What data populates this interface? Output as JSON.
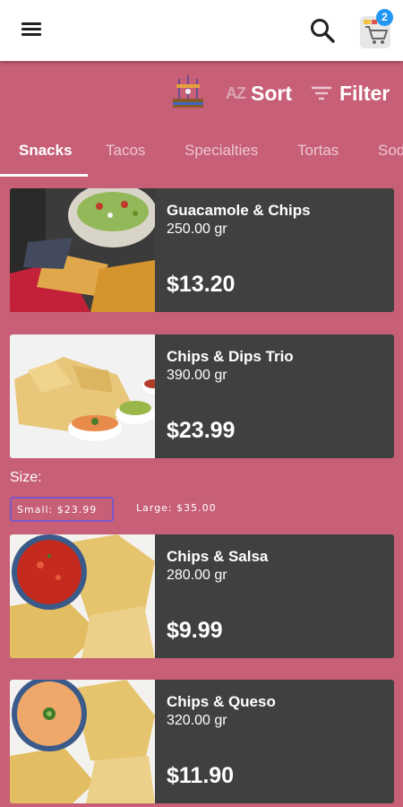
{
  "header": {
    "menu_icon": "menu-icon",
    "search_icon": "search-icon",
    "cart_icon": "cart-icon",
    "cart_count": "2"
  },
  "toolbar": {
    "sort_icon_text": "AZ",
    "sort_label": "Sort",
    "filter_label": "Filter"
  },
  "tabs": [
    {
      "label": "Snacks",
      "active": true
    },
    {
      "label": "Tacos"
    },
    {
      "label": "Specialties"
    },
    {
      "label": "Tortas"
    },
    {
      "label": "Sod"
    }
  ],
  "products": [
    {
      "name": "Guacamole & Chips",
      "weight": "250.00 gr",
      "price": "$13.20"
    },
    {
      "name": "Chips & Dips Trio",
      "weight": "390.00 gr",
      "price": "$23.99"
    },
    {
      "name": "Chips & Salsa",
      "weight": "280.00 gr",
      "price": "$9.99"
    },
    {
      "name": "Chips & Queso",
      "weight": "320.00 gr",
      "price": "$11.90"
    }
  ],
  "size_selector": {
    "label": "Size:",
    "options": [
      {
        "label": "Small: $23.99",
        "selected": true
      },
      {
        "label": "Large: $35.00"
      }
    ]
  },
  "colors": {
    "background": "#c75f77",
    "card": "#404040",
    "badge": "#2196f3",
    "selected_outline": "#7e57c2"
  }
}
